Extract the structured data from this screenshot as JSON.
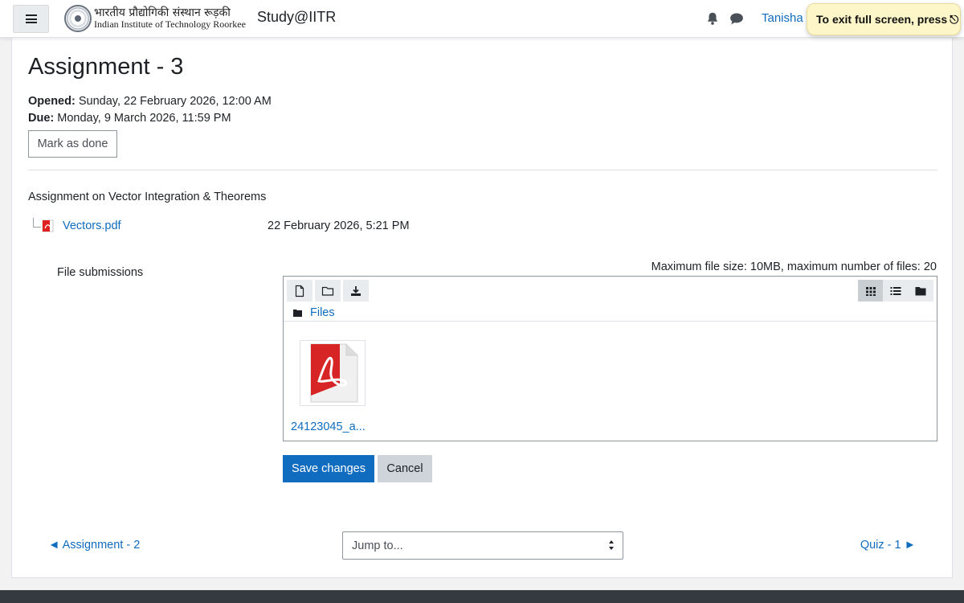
{
  "navbar": {
    "menu_icon": "hamburger-icon",
    "logo_hindi": "भारतीय प्रौद्योगिकी संस्थान रूड़की",
    "logo_english": "Indian Institute of Technology Roorkee",
    "site_name": "Study@IITR",
    "notification_icon": "bell-icon",
    "messages_icon": "chat-icon",
    "user_name": "Tanisha K"
  },
  "fullscreen_toast": {
    "text": "To exit full screen, press",
    "key_glyph": "⎋"
  },
  "assignment": {
    "title": "Assignment - 3",
    "opened_label": "Opened:",
    "opened_value": " Sunday, 22 February 2026, 12:00 AM",
    "due_label": "Due:",
    "due_value": " Monday, 9 March 2026, 11:59 PM",
    "mark_done_label": "Mark as done",
    "intro": "Assignment on Vector Integration & Theorems",
    "attachment": {
      "icon": "pdf-icon",
      "name": "Vectors.pdf",
      "date": "22 February 2026, 5:21 PM"
    }
  },
  "submission": {
    "label": "File submissions",
    "limits": "Maximum file size: 10MB, maximum number of files: 20",
    "toolbar": {
      "left": [
        "add-file-icon",
        "create-folder-icon",
        "download-icon"
      ],
      "right": [
        "grid-view-icon",
        "list-view-icon",
        "tree-view-icon"
      ],
      "active_view": "grid-view-icon"
    },
    "breadcrumb": "Files",
    "files": [
      {
        "name": "24123045_a...",
        "icon": "pdf-icon"
      }
    ],
    "save_label": "Save changes",
    "cancel_label": "Cancel"
  },
  "navigation": {
    "prev": "◄ Assignment - 2",
    "jump_placeholder": "Jump to...",
    "next": "Quiz - 1 ►"
  },
  "colors": {
    "link": "#0f6cbf",
    "primary_button": "#0f6cbf",
    "secondary_button": "#ced4da",
    "toast_bg": "#fdf6c8",
    "footer": "#343a40"
  }
}
